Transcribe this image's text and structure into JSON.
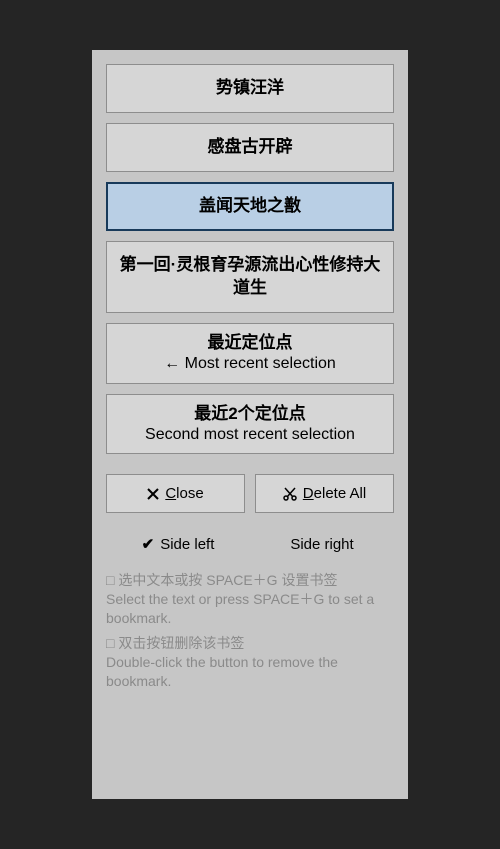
{
  "bookmarks": [
    {
      "label": "势镇汪洋"
    },
    {
      "label": "感盘古开辟"
    },
    {
      "label": "盖闻天地之敾"
    },
    {
      "label": "第一回·灵根育孕源流出心性修持大道生"
    }
  ],
  "selected_index": 2,
  "recent": [
    {
      "zh": "最近定位点",
      "arrow": "←",
      "en": "Most recent selection"
    },
    {
      "zh": "最近2个定位点",
      "en": "Second most recent selection"
    }
  ],
  "buttons": {
    "close_label": "lose",
    "close_mnemonic": "C",
    "delete_label": "elete All",
    "delete_mnemonic": "D"
  },
  "side": {
    "left_label": "Side left",
    "right_label": "Side right",
    "checked": "left"
  },
  "hints": {
    "h1_zh": "选中文本或按 SPACE＋G 设置书签",
    "h1_en": "Select the text or press SPACE＋G to set a bookmark.",
    "h2_zh": "双击按钮删除该书签",
    "h2_en": "Double-click the button to remove the bookmark."
  },
  "icons": {
    "close": "close-icon",
    "delete": "scissors-icon",
    "check": "check-icon",
    "box": "checkbox-empty-icon"
  }
}
